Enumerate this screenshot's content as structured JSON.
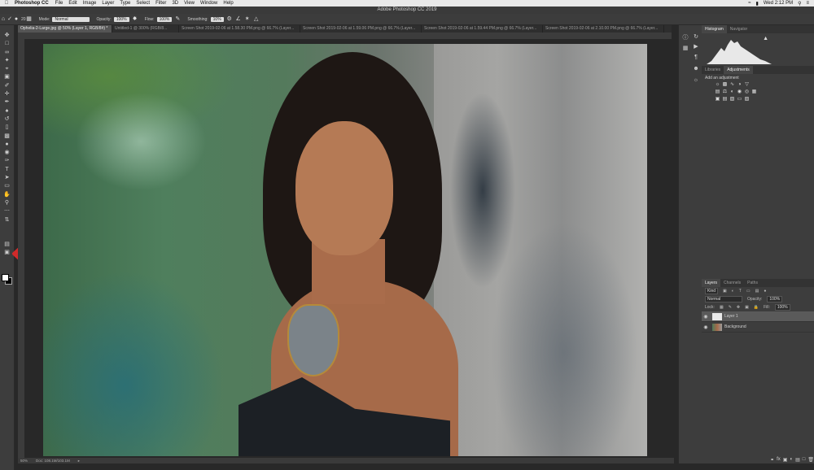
{
  "menubar": {
    "apple": "",
    "app_name": "Photoshop CC",
    "items": [
      "File",
      "Edit",
      "Image",
      "Layer",
      "Type",
      "Select",
      "Filter",
      "3D",
      "View",
      "Window",
      "Help"
    ],
    "clock": "Wed 2:12 PM"
  },
  "window_title": "Adobe Photoshop CC 2019",
  "options_bar": {
    "mode_label": "Mode:",
    "mode_value": "Normal",
    "opacity_label": "Opacity:",
    "opacity_value": "100%",
    "flow_label": "Flow:",
    "flow_value": "100%",
    "smoothing_label": "Smoothing:",
    "smoothing_value": "10%",
    "brush_size": "20"
  },
  "tabs": [
    {
      "label": "Ophelia-2-Large.jpg @ 50% (Layer 1, RGB/8#) *",
      "active": true
    },
    {
      "label": "Untitled-1 @ 300% (RGB/8...",
      "active": false
    },
    {
      "label": "Screen Shot 2019-02-06 at 1.58.30 PM.png @ 66.7% (Layer...",
      "active": false
    },
    {
      "label": "Screen Shot 2019-02-06 at 1.59.06 PM.png @ 66.7% (Layer...",
      "active": false
    },
    {
      "label": "Screen Shot 2019-02-06 at 1.59.44 PM.png @ 66.7% (Layer...",
      "active": false
    },
    {
      "label": "Screen Shot 2019-02-06 at 2.10.00 PM.png @ 66.7% (Layer...",
      "active": false
    }
  ],
  "status": {
    "zoom": "50%",
    "doc": "Doc: 108.1M/103.1M"
  },
  "panels": {
    "top_tabs": [
      "Histogram",
      "Navigator"
    ],
    "mid_tabs": [
      "Libraries",
      "Adjustments"
    ],
    "adjust_hint": "Add an adjustment",
    "layer_tabs": [
      "Layers",
      "Channels",
      "Paths"
    ],
    "kind_label": "Kind",
    "blend_mode": "Normal",
    "opacity_label": "Opacity:",
    "opacity_value": "100%",
    "lock_label": "Lock:",
    "fill_label": "Fill:",
    "fill_value": "100%",
    "layers": [
      {
        "name": "Layer 1",
        "selected": true
      },
      {
        "name": "Background",
        "selected": false
      }
    ]
  },
  "colors": {
    "annotation_arrow": "#d12a2a",
    "foreground": "#ffffff",
    "background": "#000000"
  }
}
